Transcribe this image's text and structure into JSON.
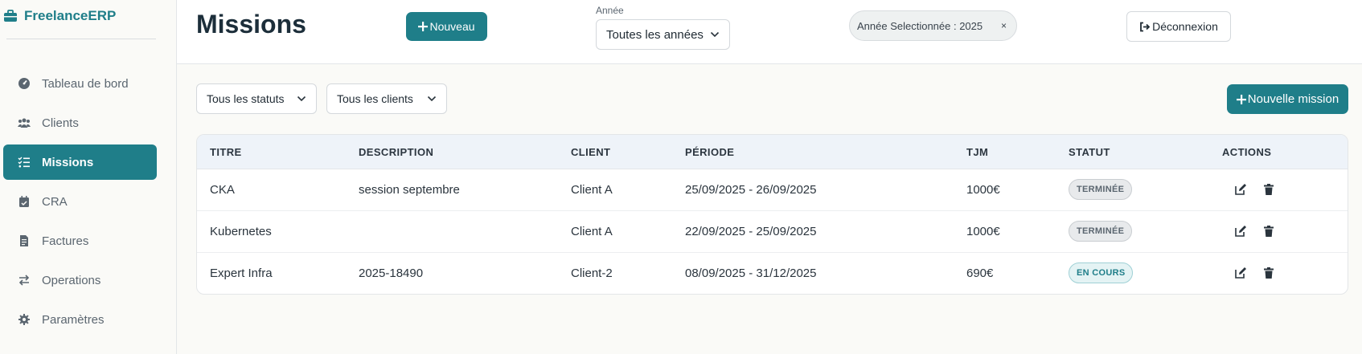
{
  "app": {
    "brand": "FreelanceERP"
  },
  "sidebar": {
    "items": [
      {
        "label": "Tableau de bord",
        "icon": "gauge-icon",
        "active": false
      },
      {
        "label": "Clients",
        "icon": "users-icon",
        "active": false
      },
      {
        "label": "Missions",
        "icon": "list-check-icon",
        "active": true
      },
      {
        "label": "CRA",
        "icon": "calendar-check-icon",
        "active": false
      },
      {
        "label": "Factures",
        "icon": "invoice-icon",
        "active": false
      },
      {
        "label": "Operations",
        "icon": "exchange-icon",
        "active": false
      },
      {
        "label": "Paramètres",
        "icon": "gear-icon",
        "active": false
      }
    ]
  },
  "header": {
    "title": "Missions",
    "new_button": "Nouveau",
    "year_label": "Année",
    "year_select": "Toutes les années",
    "selected_year_chip": "Année Selectionnée : 2025",
    "chip_close": "×",
    "logout_button": "Déconnexion"
  },
  "filters": {
    "status_select": "Tous les statuts",
    "client_select": "Tous les clients",
    "new_mission_button": "Nouvelle mission"
  },
  "table": {
    "columns": [
      "TITRE",
      "DESCRIPTION",
      "CLIENT",
      "PÉRIODE",
      "TJM",
      "STATUT",
      "ACTIONS"
    ],
    "rows": [
      {
        "titre": "CKA",
        "description": "session septembre",
        "client": "Client A",
        "periode": "25/09/2025 - 26/09/2025",
        "tjm": "1000€",
        "statut": "TERMINÉE"
      },
      {
        "titre": "Kubernetes",
        "description": "",
        "client": "Client A",
        "periode": "22/09/2025 - 25/09/2025",
        "tjm": "1000€",
        "statut": "TERMINÉE"
      },
      {
        "titre": "Expert Infra",
        "description": "2025-18490",
        "client": "Client-2",
        "periode": "08/09/2025 - 31/12/2025",
        "tjm": "690€",
        "statut": "EN COURS"
      }
    ]
  },
  "colors": {
    "accent": "#1f7e89",
    "header_bg": "#ffffff",
    "page_bg": "#fafaf7"
  }
}
